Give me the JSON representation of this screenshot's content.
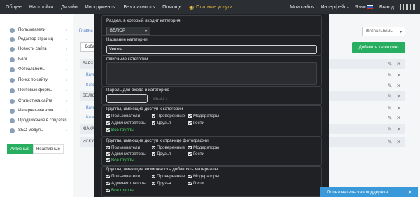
{
  "topbar": {
    "nav": [
      "Общее",
      "Настройки",
      "Дизайн",
      "Инструменты",
      "Безопасность",
      "Помощь"
    ],
    "paid": "Платные услуги",
    "right": {
      "my_sites": "Мои сайты",
      "interface": "Интерфейс",
      "language": "Язык",
      "logout": "Выход"
    }
  },
  "sidebar": {
    "items": [
      "Пользователи",
      "Редактор страниц",
      "Новости сайта",
      "Блог",
      "Фотоальбомы",
      "Поиск по сайту",
      "Почтовые формы",
      "Статистика сайта",
      "Интернет-магазин",
      "Продвижение в соцсетях",
      "SEO-модуль"
    ],
    "tabs": {
      "active": "Активные",
      "inactive": "Неактивные"
    }
  },
  "main": {
    "breadcrumb": "Главна",
    "left_button": "Доба",
    "album_select": "Фотоальбомы",
    "add_category": "Добавить категорию",
    "rows": [
      {
        "type": "cat",
        "label": "БАРХ"
      },
      {
        "type": "sub",
        "label": "Кате"
      },
      {
        "type": "sub",
        "label": "Кате"
      },
      {
        "type": "cat",
        "label": "ВЕЛЮ"
      },
      {
        "type": "sub",
        "label": "Кате"
      },
      {
        "type": "sub",
        "label": "Кате"
      },
      {
        "type": "cat",
        "label": "ЖАКА"
      },
      {
        "type": "cat",
        "label": "ИСКУ"
      }
    ]
  },
  "modal": {
    "section_label": "Раздел, в который входит категория",
    "section_value": "ВЕЛЮР",
    "name_label": "Название категории",
    "name_value": "Verona",
    "desc_label": "Описание категории",
    "password_label": "Пароль для входа в категорию",
    "password_hint": "(0-9a-zA-Z_)",
    "group1": {
      "title": "Группы, имеющие доступ к категории",
      "items": [
        "Пользователи",
        "Проверенные",
        "Модераторы",
        "Администраторы",
        "Друзья",
        "Гости"
      ],
      "all": "Все группы"
    },
    "group2": {
      "title": "Группы, имеющие доступ к странице фотографии",
      "items": [
        "Пользователи",
        "Проверенные",
        "Модераторы",
        "Администраторы",
        "Друзья",
        "Гости"
      ],
      "all": "Все группы"
    },
    "group3": {
      "title": "Группы, имеющие возможность добавлять материалы",
      "items": [
        "Пользователи",
        "Проверенные",
        "Модераторы",
        "Администраторы",
        "Друзья",
        "Гости"
      ],
      "all": "Все группы"
    }
  },
  "support": {
    "label": "Пользовательская поддержка"
  }
}
